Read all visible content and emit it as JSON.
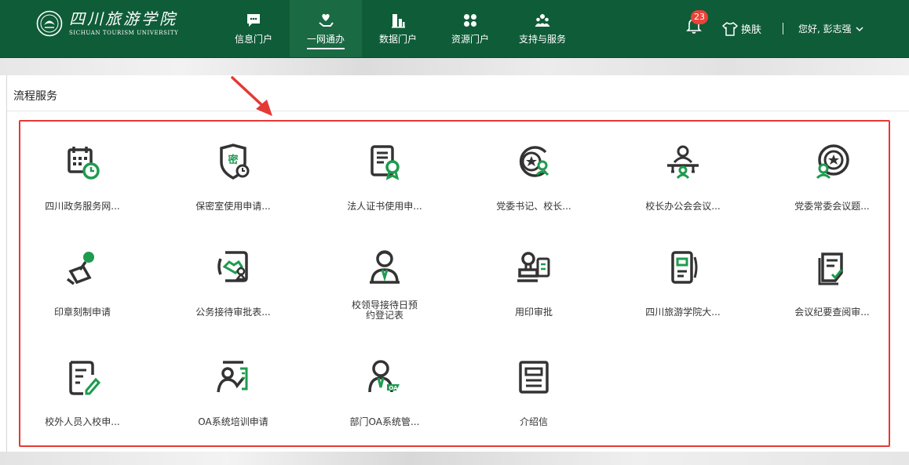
{
  "brand": {
    "name_cn": "四川旅游学院",
    "name_en": "SICHUAN TOURISM UNIVERSITY"
  },
  "nav": {
    "items": [
      {
        "label": "信息门户",
        "icon": "chat-bubble-icon"
      },
      {
        "label": "一网通办",
        "icon": "heart-hand-icon"
      },
      {
        "label": "数据门户",
        "icon": "building-chart-icon"
      },
      {
        "label": "资源门户",
        "icon": "four-leaf-icon"
      },
      {
        "label": "支持与服务",
        "icon": "people-group-icon"
      }
    ],
    "active_index": 1
  },
  "header": {
    "notification_count": "23",
    "skin_label": "换肤",
    "greeting": "您好, 彭志强"
  },
  "section": {
    "title": "流程服务"
  },
  "services": [
    {
      "label": "四川政务服务网...",
      "icon": "calendar-clock-icon"
    },
    {
      "label": "保密室使用申请...",
      "icon": "secret-shield-icon"
    },
    {
      "label": "法人证书使用申...",
      "icon": "certificate-icon"
    },
    {
      "label": "党委书记、校长...",
      "icon": "star-seal-user-icon"
    },
    {
      "label": "校长办公会会议...",
      "icon": "meeting-table-icon"
    },
    {
      "label": "党委常委会议题...",
      "icon": "star-seal-group-icon"
    },
    {
      "label": "印章刻制申请",
      "icon": "stamp-icon"
    },
    {
      "label": "公务接待审批表...",
      "icon": "handshake-icon"
    },
    {
      "label": "校领导接待日预约登记表",
      "icon": "leader-icon"
    },
    {
      "label": "用印审批",
      "icon": "stamp-document-icon"
    },
    {
      "label": "四川旅游学院大...",
      "icon": "document-brackets-icon"
    },
    {
      "label": "会议纪要查阅审...",
      "icon": "minutes-check-icon"
    },
    {
      "label": "校外人员入校申...",
      "icon": "edit-form-icon"
    },
    {
      "label": "OA系统培训申请",
      "icon": "trainer-board-icon"
    },
    {
      "label": "部门OA系统管...",
      "icon": "oa-admin-icon"
    },
    {
      "label": "介绍信",
      "icon": "letter-icon"
    }
  ],
  "colors": {
    "header_bg": "#0f5c38",
    "icon_dark": "#333333",
    "icon_accent": "#1e9b4f",
    "highlight_border": "#e53935",
    "badge": "#e8433a"
  }
}
